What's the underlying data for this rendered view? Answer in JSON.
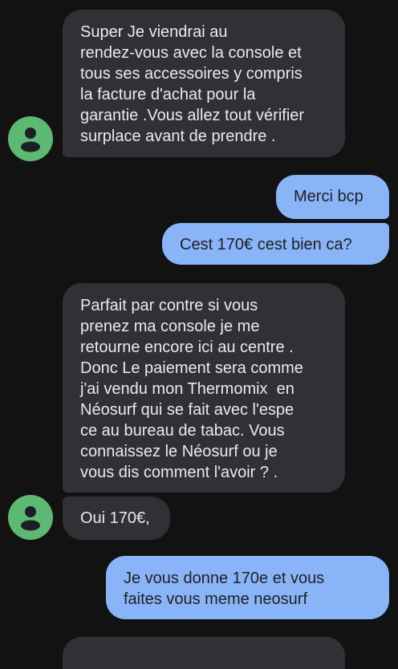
{
  "conversation": {
    "messages": [
      {
        "direction": "incoming",
        "text": "Super Je viendrai au\nrendez-vous avec la console et\ntous ses accessoires y compris\nla facture d'achat pour la\ngarantie .Vous allez tout vérifier\nsurplace avant de prendre ."
      },
      {
        "direction": "outgoing",
        "text": "Merci bcp"
      },
      {
        "direction": "outgoing",
        "text": "Cest 170€ cest bien ca?"
      },
      {
        "direction": "incoming",
        "text": "Parfait par contre si vous\nprenez ma console je me\nretourne encore ici au centre .\nDonc Le paiement sera comme\nj'ai vendu mon Thermomix  en\nNéosurf qui se fait avec l'espe\nce au bureau de tabac. Vous\nconnaissez le Néosurf ou je\nvous dis comment l'avoir ? ."
      },
      {
        "direction": "incoming",
        "text": "Oui 170€,"
      },
      {
        "direction": "outgoing",
        "text": "Je vous donne 170e et vous\nfaites vous meme neosurf"
      }
    ],
    "contact_avatar": {
      "icon": "person-icon",
      "color": "#5bb974"
    }
  },
  "theme": {
    "background": "#121212",
    "incoming_bubble": "#303134",
    "outgoing_bubble": "#8ab4f8",
    "incoming_text": "#e8eaed",
    "outgoing_text": "#202124"
  }
}
